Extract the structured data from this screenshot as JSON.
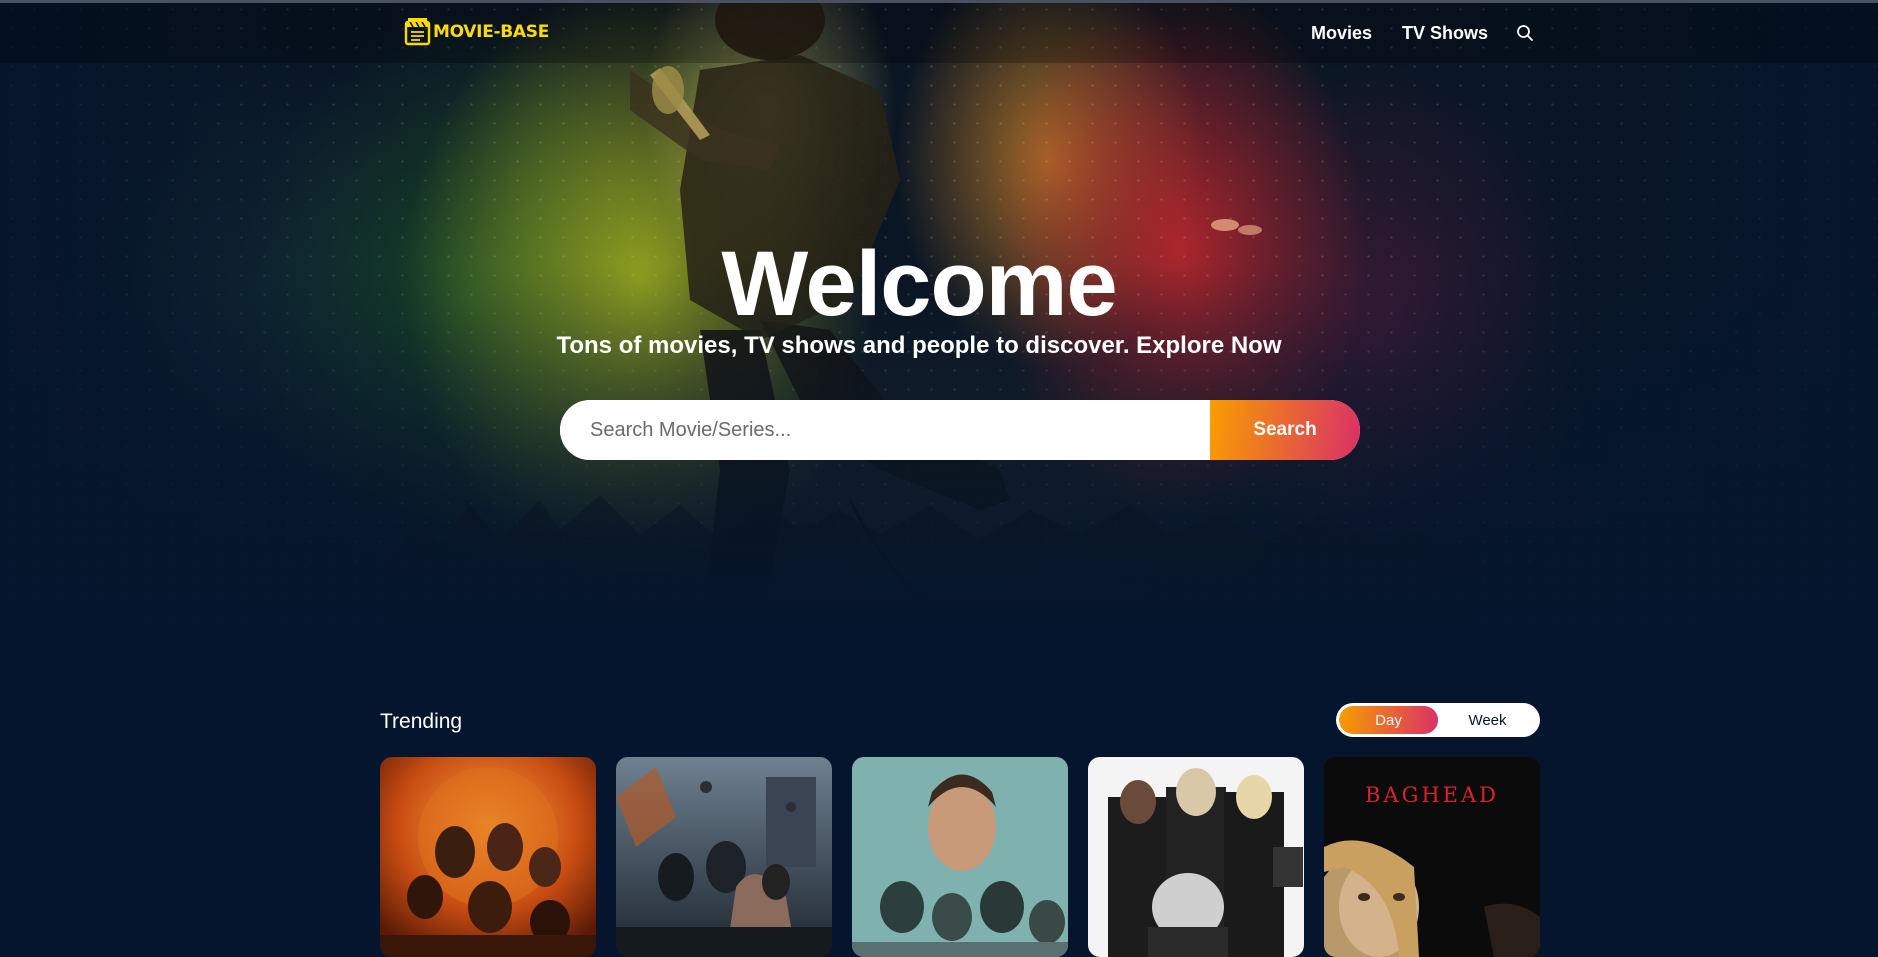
{
  "header": {
    "logo_text": "MOVIE-BASE",
    "nav": [
      {
        "label": "Movies"
      },
      {
        "label": "TV Shows"
      }
    ],
    "search_icon": "search-icon"
  },
  "hero": {
    "title": "Welcome",
    "subtitle": "Tons of movies, TV shows and people to discover. Explore Now",
    "search_placeholder": "Search Movie/Series...",
    "search_button": "Search"
  },
  "trending": {
    "title": "Trending",
    "tabs": [
      {
        "label": "Day",
        "active": true
      },
      {
        "label": "Week",
        "active": false
      }
    ],
    "cards": [
      {
        "poster_text": ""
      },
      {
        "poster_text": ""
      },
      {
        "poster_text": ""
      },
      {
        "poster_text": ""
      },
      {
        "poster_text": "BAGHEAD"
      }
    ]
  },
  "colors": {
    "background": "#04152d",
    "accent_start": "#f89e00",
    "accent_end": "#da2f68",
    "logo": "#fcdb00"
  }
}
